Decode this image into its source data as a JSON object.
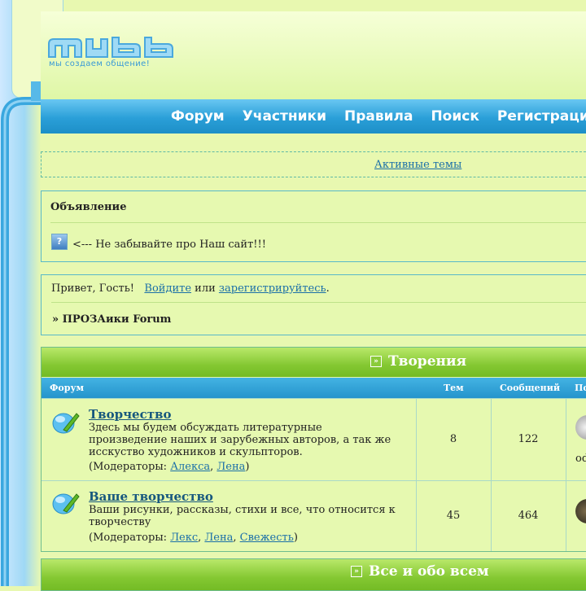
{
  "logo": {
    "text": "mybb",
    "tagline": "мы создаем общение!"
  },
  "nav": {
    "items": [
      "Форум",
      "Участники",
      "Правила",
      "Поиск",
      "Регистрация"
    ]
  },
  "active_topics": "Активные темы",
  "announcement": {
    "title": "Объявление",
    "icon": "?",
    "message": "<--- Не забывайте про Наш сайт!!!"
  },
  "welcome": {
    "greeting": "Привет, Гость!",
    "login": "Войдите",
    "or": "или",
    "register": "зарегистрируйтесь",
    "period": ".",
    "breadcrumb": "» ПРОЗАики Forum"
  },
  "category1": {
    "title": "Творения",
    "columns": {
      "forum": "Форум",
      "topics": "Тем",
      "posts": "Сообщений",
      "last": "По"
    },
    "forums": [
      {
        "title": "Творчество",
        "desc": "Здесь мы будем обсуждать литературные произведение наших и зарубежных авторов, а так же исскуство художников и скульпторов.",
        "mods_prefix": "(Модераторы:",
        "mods": [
          "Алекса",
          "Лена"
        ],
        "mods_suffix": ")",
        "topics": "8",
        "posts": "122",
        "last_author": "od"
      },
      {
        "title": "Ваше творчество",
        "desc": "Ваши рисунки, рассказы, стихи и все, что относится к творчеству",
        "mods_prefix": "(Модераторы:",
        "mods": [
          "Лекс",
          "Лена",
          "Свежесть"
        ],
        "mods_suffix": ")",
        "topics": "45",
        "posts": "464",
        "last_author": ""
      }
    ]
  },
  "category2": {
    "title": "Все и обо всем"
  },
  "colors": {
    "nav_blue": "#2a9fd8",
    "header_green": "#84c832",
    "link": "#1a6fa8",
    "bg": "#e8f8b0"
  }
}
